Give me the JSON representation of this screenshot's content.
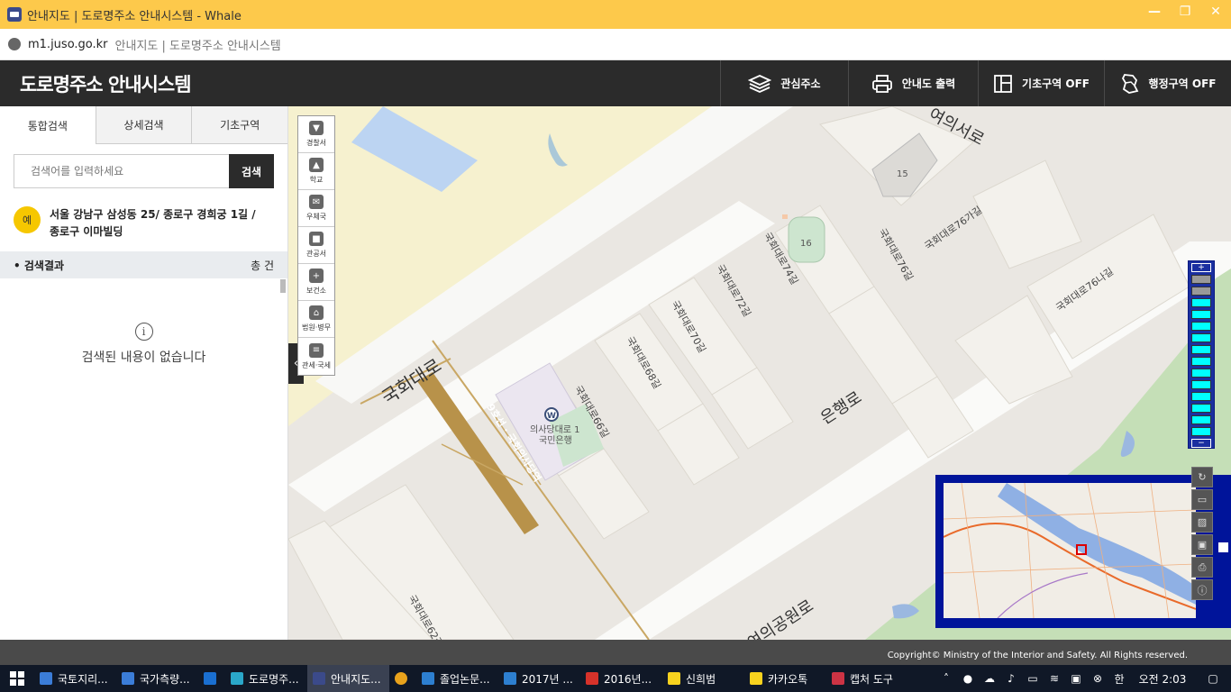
{
  "window": {
    "title": "안내지도 | 도로명주소 안내시스템 - Whale"
  },
  "browser": {
    "host": "m1.juso.go.kr",
    "page_title": "안내지도 | 도로명주소 안내시스템"
  },
  "header": {
    "brand": "도로명주소 안내시스템",
    "nav": [
      {
        "label": "관심주소",
        "icon": "layers-icon"
      },
      {
        "label": "안내도 출력",
        "icon": "printer-icon"
      },
      {
        "label": "기초구역 OFF",
        "icon": "grid-icon"
      },
      {
        "label": "행정구역 OFF",
        "icon": "map-region-icon"
      }
    ]
  },
  "sidebar": {
    "tabs": [
      "통합검색",
      "상세검색",
      "기초구역"
    ],
    "search": {
      "placeholder": "검색어를 입력하세요",
      "button": "검색"
    },
    "example": {
      "badge": "예",
      "text": "서울 강남구 삼성동 25/ 종로구 경희궁 1길 / 종로구 이마빌딩"
    },
    "result": {
      "label": "검색결과",
      "count": "총 건"
    },
    "empty": {
      "icon": "i",
      "message": "검색된 내용이 없습니다"
    }
  },
  "poi_toolbar": [
    {
      "label": "경찰서",
      "icon": "police-icon"
    },
    {
      "label": "학교",
      "icon": "school-icon"
    },
    {
      "label": "우체국",
      "icon": "post-office-icon"
    },
    {
      "label": "관공서",
      "icon": "government-office-icon"
    },
    {
      "label": "보건소",
      "icon": "health-center-icon"
    },
    {
      "label": "법원·병무",
      "icon": "court-icon"
    },
    {
      "label": "관세·국세",
      "icon": "tax-office-icon"
    }
  ],
  "map": {
    "labels": {
      "yeouiseoro": "여의서로",
      "gukhoedaero": "국회대로",
      "eunhaengro": "은행로",
      "yeouigongwonro": "여의공원로",
      "bank": "의사당대로 1",
      "bank2": "국민은행",
      "bank_icon": "W",
      "gil66": "국회대로66길",
      "gil68": "국회대로68길",
      "gil70": "국회대로70길",
      "gil72": "국회대로72길",
      "gil74": "국회대로74길",
      "gil76": "국회대로76길",
      "gil76ga": "국회대로76가길",
      "gil76na": "국회대로76나길",
      "gil62": "국회대로62길",
      "bldg15": "15",
      "bldg16": "16",
      "uisadangdaero": "9호선 · 국회의사당역"
    }
  },
  "zoom": {
    "plus": "+",
    "minus": "−",
    "levels": 14,
    "active_level": 13
  },
  "minimap_tools": [
    "refresh-icon",
    "ruler-icon",
    "area-icon",
    "save-icon",
    "print-icon",
    "info-icon"
  ],
  "footer": {
    "copyright": "Copyright© Ministry of the Interior and Safety. All Rights reserved."
  },
  "taskbar": {
    "items": [
      {
        "label": "국토지리...",
        "color": "#3b7dd8"
      },
      {
        "label": "국가측량...",
        "color": "#3b7dd8"
      },
      {
        "label": "",
        "color": "#1a6fd1"
      },
      {
        "label": "도로명주...",
        "color": "#2aa7c9"
      },
      {
        "label": "안내지도...",
        "color": "#3b4a8a"
      },
      {
        "label": "",
        "color": "#e8a21c"
      },
      {
        "label": "졸업논문...",
        "color": "#2d7fd0"
      },
      {
        "label": "2017년 ...",
        "color": "#2d7fd0"
      },
      {
        "label": "2016년...",
        "color": "#d7322a"
      },
      {
        "label": "신희범",
        "color": "#f7d21e"
      },
      {
        "label": "카카오톡",
        "color": "#f7d21e"
      },
      {
        "label": "캡처 도구",
        "color": "#cc3344"
      }
    ],
    "clock": "오전 2:03"
  }
}
